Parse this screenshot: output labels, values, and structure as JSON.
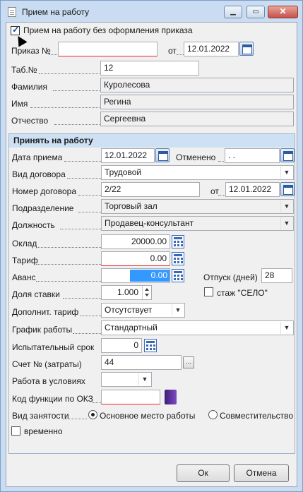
{
  "window": {
    "title": "Прием на работу",
    "minimize": "▁",
    "maximize": "▭",
    "close": "✕"
  },
  "header": {
    "no_order_checkbox": {
      "label": "Прием на работу без оформления приказа",
      "checked": true
    },
    "order_no": {
      "label": "Приказ №",
      "value": ""
    },
    "order_date": {
      "label": "от",
      "value": "12.01.2022"
    },
    "tab_no": {
      "label": "Таб.№",
      "value": "12"
    },
    "last_name": {
      "label": "Фамилия",
      "value": "Куролесова"
    },
    "first_name": {
      "label": "Имя",
      "value": "Регина"
    },
    "patronymic": {
      "label": "Отчество",
      "value": "Сергеевна"
    }
  },
  "hire": {
    "group_title": "Принять на работу",
    "hire_date": {
      "label": "Дата приема",
      "value": "12.01.2022"
    },
    "cancelled": {
      "label": "Отменено",
      "value": ".  ."
    },
    "contract_type": {
      "label": "Вид договора",
      "value": "Трудовой"
    },
    "contract_no": {
      "label": "Номер договора",
      "value": "2/22"
    },
    "contract_date": {
      "label": "от",
      "value": "12.01.2022"
    },
    "department": {
      "label": "Подразделение",
      "value": "Торговый зал"
    },
    "position": {
      "label": "Должность",
      "value": "Продавец-консультант"
    },
    "salary": {
      "label": "Оклад",
      "value": "20000.00"
    },
    "tariff": {
      "label": "Тариф",
      "value": "0.00"
    },
    "advance": {
      "label": "Аванс",
      "value": "0.00"
    },
    "vacation": {
      "label": "Отпуск (дней)",
      "value": "28"
    },
    "rate_share": {
      "label": "Доля ставки",
      "value": "1.000"
    },
    "selo": {
      "label": "стаж \"СЕЛО\"",
      "checked": false
    },
    "extra_tariff": {
      "label": "Дополнит. тариф",
      "value": "Отсутствует"
    },
    "schedule": {
      "label": "График работы",
      "value": "Стандартный"
    },
    "probation": {
      "label": "Испытательный срок",
      "value": "0"
    },
    "account": {
      "label": "Счет № (затраты)",
      "value": "44",
      "button": "..."
    },
    "conditions": {
      "label": "Работа в условиях",
      "value": ""
    },
    "okz": {
      "label": "Код функции по ОКЗ",
      "value": ""
    },
    "employment": {
      "label": "Вид занятости",
      "options": [
        "Основное место работы",
        "Совместительство"
      ],
      "selected": 0
    },
    "temporary": {
      "label": "временно",
      "checked": false
    }
  },
  "buttons": {
    "ok": "Ок",
    "cancel": "Отмена"
  },
  "colors": {
    "titlebar": "#c9dcf1",
    "group_header": "#cde0f4",
    "selection": "#3399ff",
    "close_button": "#c75050"
  }
}
